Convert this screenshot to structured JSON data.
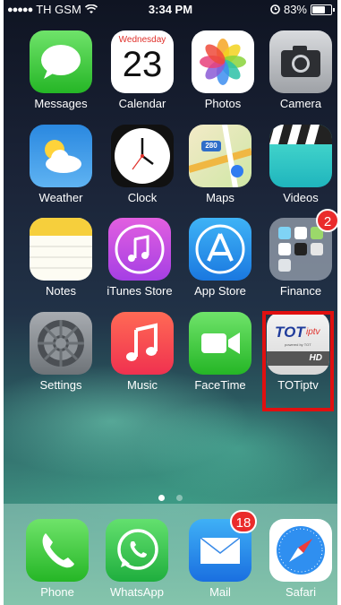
{
  "status_bar": {
    "carrier": "TH GSM",
    "time": "3:34 PM",
    "battery": "83%",
    "battery_level": 0.83
  },
  "calendar": {
    "weekday": "Wednesday",
    "day": "23"
  },
  "maps_shield": "280",
  "apps": [
    {
      "label": "Messages"
    },
    {
      "label": "Calendar"
    },
    {
      "label": "Photos"
    },
    {
      "label": "Camera"
    },
    {
      "label": "Weather"
    },
    {
      "label": "Clock"
    },
    {
      "label": "Maps"
    },
    {
      "label": "Videos"
    },
    {
      "label": "Notes"
    },
    {
      "label": "iTunes Store"
    },
    {
      "label": "App Store"
    },
    {
      "label": "Finance",
      "badge": "2"
    },
    {
      "label": "Settings"
    },
    {
      "label": "Music"
    },
    {
      "label": "FaceTime"
    },
    {
      "label": "TOTiptv"
    }
  ],
  "totiptv": {
    "logo": "TOT",
    "sub": "iptv",
    "tag": "powered by TOT",
    "hd": "HD"
  },
  "dock": [
    {
      "label": "Phone"
    },
    {
      "label": "WhatsApp"
    },
    {
      "label": "Mail",
      "badge": "18"
    },
    {
      "label": "Safari"
    }
  ],
  "page_indicator": {
    "pages": 2,
    "current": 1
  }
}
